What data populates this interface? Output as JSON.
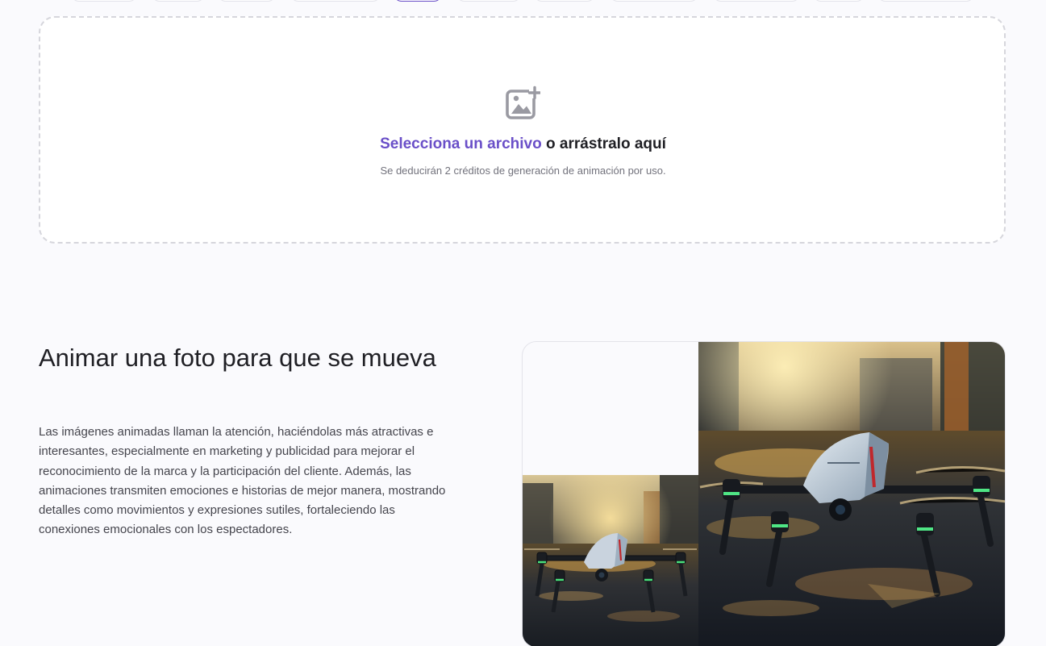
{
  "upload": {
    "link_text": "Selecciona un archivo",
    "rest_text": " o arrástralo aquí",
    "note": "Se deducirán 2 créditos de generación de animación por uso.",
    "icon": "add-image-icon"
  },
  "feature": {
    "title": "Animar una foto para que se mueva",
    "description": "Las imágenes animadas llaman la atención, haciéndolas más atractivas e interesantes, especialmente en marketing y publicidad para mejorar el reconocimiento de la marca y la participación del cliente. Además, las animaciones transmiten emociones e historias de mejor manera, mostrando detalles como movimientos y expresiones sutiles, fortaleciendo las conexiones emocionales con los espectadores."
  },
  "colors": {
    "accent": "#6a4fc8",
    "background": "#fafafd",
    "text": "#1f1f24",
    "muted": "#72727c"
  }
}
